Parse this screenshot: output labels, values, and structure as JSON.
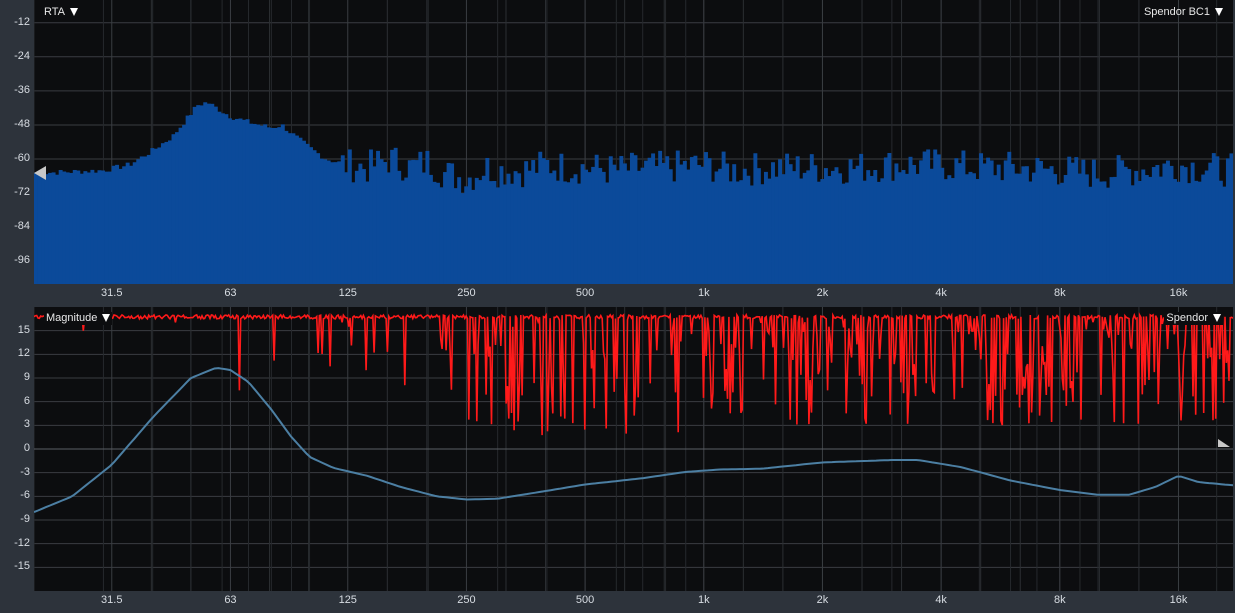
{
  "rta": {
    "title": "RTA",
    "source": "Spendor BC1",
    "y_ticks": [
      "-12",
      "-24",
      "-36",
      "-48",
      "-60",
      "-72",
      "-84",
      "-96"
    ],
    "x_ticks": [
      "31.5",
      "63",
      "125",
      "250",
      "500",
      "1k",
      "2k",
      "4k",
      "8k",
      "16k"
    ],
    "bar_color": "#0b4a9a",
    "handle_level_db": -60
  },
  "magnitude": {
    "title": "Magnitude",
    "source": "Spendor",
    "y_ticks": [
      "15",
      "12",
      "9",
      "6",
      "3",
      "0",
      "-3",
      "-6",
      "-9",
      "-12",
      "-15"
    ],
    "x_ticks": [
      "31.5",
      "63",
      "125",
      "250",
      "500",
      "1k",
      "2k",
      "4k",
      "8k",
      "16k"
    ],
    "coherence_color": "#ff1a1a",
    "magnitude_color": "#4c7fa3"
  },
  "chart_data": [
    {
      "type": "bar",
      "name": "rta",
      "x_scale": "log",
      "xlim": [
        20,
        22000
      ],
      "ylim": [
        -104,
        -4
      ],
      "y_ticks": [
        -12,
        -24,
        -36,
        -48,
        -60,
        -72,
        -84,
        -96
      ],
      "x_ticks": [
        31.5,
        63,
        125,
        250,
        500,
        1000,
        2000,
        4000,
        8000,
        16000
      ],
      "envelope": [
        [
          20,
          -65
        ],
        [
          30,
          -64
        ],
        [
          35,
          -62
        ],
        [
          40,
          -57
        ],
        [
          45,
          -52
        ],
        [
          50,
          -44
        ],
        [
          52,
          -41
        ],
        [
          55,
          -40
        ],
        [
          58,
          -42
        ],
        [
          63,
          -45
        ],
        [
          70,
          -47
        ],
        [
          80,
          -49
        ],
        [
          85,
          -48
        ],
        [
          90,
          -51
        ],
        [
          100,
          -56
        ],
        [
          110,
          -60
        ],
        [
          125,
          -62
        ],
        [
          140,
          -63
        ],
        [
          160,
          -60
        ],
        [
          180,
          -63
        ],
        [
          200,
          -61
        ],
        [
          220,
          -65
        ],
        [
          250,
          -67
        ],
        [
          280,
          -63
        ],
        [
          300,
          -64
        ],
        [
          350,
          -64
        ],
        [
          400,
          -62
        ],
        [
          450,
          -63
        ],
        [
          500,
          -63
        ],
        [
          600,
          -64
        ],
        [
          700,
          -63
        ],
        [
          800,
          -63
        ],
        [
          1000,
          -62
        ],
        [
          1200,
          -64
        ],
        [
          1500,
          -63
        ],
        [
          2000,
          -63
        ],
        [
          2500,
          -63
        ],
        [
          3000,
          -62
        ],
        [
          4000,
          -62
        ],
        [
          5000,
          -63
        ],
        [
          6000,
          -63
        ],
        [
          8000,
          -64
        ],
        [
          10000,
          -65
        ],
        [
          12000,
          -64
        ],
        [
          14000,
          -63
        ],
        [
          16000,
          -62
        ],
        [
          18000,
          -63
        ],
        [
          22000,
          -64
        ]
      ]
    },
    {
      "type": "line",
      "name": "magnitude",
      "x_scale": "log",
      "xlim": [
        20,
        22000
      ],
      "ylim": [
        -18,
        18
      ],
      "y_ticks": [
        15,
        12,
        9,
        6,
        3,
        0,
        -3,
        -6,
        -9,
        -12,
        -15
      ],
      "x_ticks": [
        31.5,
        63,
        125,
        250,
        500,
        1000,
        2000,
        4000,
        8000,
        16000
      ],
      "magnitude_db": [
        [
          20,
          -8
        ],
        [
          25,
          -6
        ],
        [
          31.5,
          -2
        ],
        [
          40,
          4
        ],
        [
          50,
          9
        ],
        [
          58,
          10.3
        ],
        [
          63,
          10
        ],
        [
          70,
          8.5
        ],
        [
          80,
          5
        ],
        [
          90,
          1.5
        ],
        [
          100,
          -1
        ],
        [
          115,
          -2.4
        ],
        [
          140,
          -3.4
        ],
        [
          170,
          -4.8
        ],
        [
          210,
          -6
        ],
        [
          250,
          -6.4
        ],
        [
          300,
          -6.3
        ],
        [
          400,
          -5.3
        ],
        [
          500,
          -4.5
        ],
        [
          700,
          -3.7
        ],
        [
          900,
          -2.9
        ],
        [
          1100,
          -2.6
        ],
        [
          1400,
          -2.5
        ],
        [
          2000,
          -1.7
        ],
        [
          3000,
          -1.4
        ],
        [
          3500,
          -1.4
        ],
        [
          4500,
          -2.3
        ],
        [
          6000,
          -4
        ],
        [
          8000,
          -5.2
        ],
        [
          10000,
          -5.8
        ],
        [
          12000,
          -5.8
        ],
        [
          14000,
          -4.8
        ],
        [
          16000,
          -3.4
        ],
        [
          18000,
          -4.2
        ],
        [
          22000,
          -4.6
        ]
      ],
      "coherence_ceiling_db": 17
    }
  ]
}
